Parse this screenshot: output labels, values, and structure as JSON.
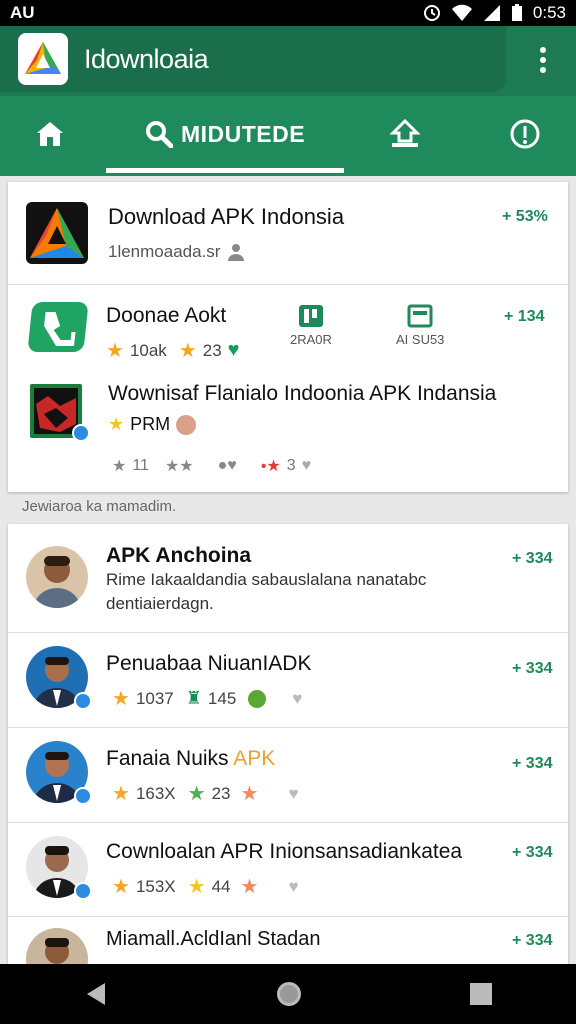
{
  "status_bar": {
    "carrier": "AU",
    "time": "0:53"
  },
  "app_bar": {
    "title": "Idownloaia"
  },
  "tabs": [
    {
      "label": "",
      "icon": "home-icon"
    },
    {
      "label": "MIDUTEDE",
      "icon": "search-icon",
      "selected": true
    },
    {
      "label": "",
      "icon": "upload-icon"
    },
    {
      "label": "",
      "icon": "info-icon"
    }
  ],
  "top_card": {
    "featured": {
      "title": "Download APK Indonsia",
      "subtitle": "1lenmoaada.sr",
      "badge": "+ 53%"
    },
    "app2": {
      "title": "Doonae Aokt",
      "rating": "10ak",
      "rating2": "23",
      "badge": "+ 134",
      "mini1_label": "2RA0R",
      "mini2_label": "AI SU53"
    },
    "app3": {
      "title": "Wownisaf Flanialo Indoonia APK Indansia",
      "subtitle": "PRM",
      "count1": "11",
      "count2": "3"
    }
  },
  "section_note": "Jewiaroa ka mamadim.",
  "list": [
    {
      "title": "APK Anchoina",
      "desc1": "Rime Iakaaldandia sabauslalana nanatabc",
      "desc2": "dentiaierdagn.",
      "badge": "+ 334"
    },
    {
      "title": "Penuabaa NiuanIADK",
      "s1": "1037",
      "s2": "145",
      "badge": "+ 334"
    },
    {
      "title_a": "Fanaia Nuiks ",
      "title_b": "APK",
      "s1": "163X",
      "s2": "23",
      "badge": "+ 334"
    },
    {
      "title": "Cownloalan APR Inionsansadiankatea",
      "s1": "153X",
      "s2": "44",
      "badge": "+ 334"
    },
    {
      "title": "Miamall.AcldIanl Stadan",
      "badge": "+ 334"
    }
  ],
  "colors": {
    "primary": "#1f8a5c",
    "dark": "#1b6e4b",
    "accent": "#1e8a5a",
    "star": "#f5a623"
  }
}
